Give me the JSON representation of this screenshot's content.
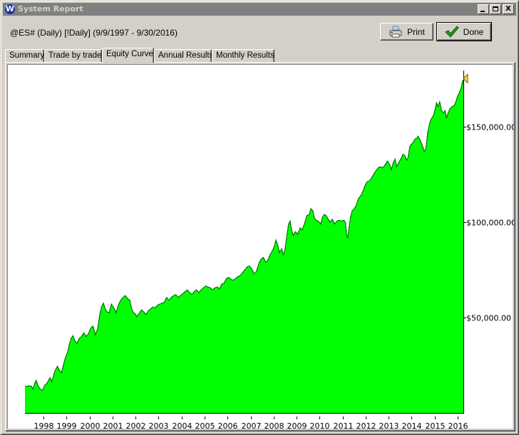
{
  "window": {
    "title": "System Report",
    "app_icon": "W",
    "controls": [
      "minimize-icon",
      "maximize-icon",
      "close-icon"
    ],
    "close_glyph": "X"
  },
  "header": {
    "subtitle": "@ES# (Daily) [!Daily]  (9/9/1997 - 9/30/2016)"
  },
  "buttons": {
    "print_label": "Print",
    "print_icon": "printer-icon",
    "done_label": "Done",
    "done_icon": "checkmark-icon"
  },
  "tabs": [
    {
      "label": "Summary",
      "active": false
    },
    {
      "label": "Trade by trade",
      "active": false
    },
    {
      "label": "Equity Curve",
      "active": true
    },
    {
      "label": "Annual Results",
      "active": false
    },
    {
      "label": "Monthly Results",
      "active": false
    }
  ],
  "colors": {
    "fill": "#00ff00",
    "line": "#007f00",
    "marker": "#ffdd33",
    "title_bar": "#808080",
    "title_text": "#d4d0c8"
  },
  "chart_data": {
    "type": "area",
    "title": "Equity Curve",
    "xlabel": "",
    "ylabel": "",
    "x_tick_labels": [
      "1998",
      "1999",
      "2000",
      "2001",
      "2002",
      "2003",
      "2004",
      "2005",
      "2006",
      "2007",
      "2008",
      "2009",
      "2010",
      "2011",
      "2012",
      "2013",
      "2014",
      "2015",
      "2016"
    ],
    "y_tick_labels": [
      "$50,000.00",
      "$100,000.00",
      "$150,000.00"
    ],
    "y_ticks": [
      50000,
      100000,
      150000
    ],
    "x_range": [
      1997.69,
      2016.75
    ],
    "ylim": [
      0,
      178000
    ],
    "y_axis_position": "right",
    "grid": false,
    "end_marker": "yellow-flag",
    "series": [
      {
        "name": "Equity",
        "points": [
          [
            1997.69,
            14000
          ],
          [
            1997.8,
            14000
          ],
          [
            1997.95,
            14200
          ],
          [
            1998.05,
            12500
          ],
          [
            1998.1,
            15000
          ],
          [
            1998.18,
            17000
          ],
          [
            1998.25,
            14500
          ],
          [
            1998.35,
            12500
          ],
          [
            1998.45,
            11800
          ],
          [
            1998.55,
            14500
          ],
          [
            1998.65,
            15500
          ],
          [
            1998.78,
            18500
          ],
          [
            1998.85,
            16500
          ],
          [
            1998.92,
            19000
          ],
          [
            1999.0,
            22000
          ],
          [
            1999.1,
            24500
          ],
          [
            1999.2,
            22000
          ],
          [
            1999.28,
            21000
          ],
          [
            1999.35,
            24500
          ],
          [
            1999.45,
            29000
          ],
          [
            1999.55,
            32000
          ],
          [
            1999.62,
            36000
          ],
          [
            1999.7,
            39000
          ],
          [
            1999.78,
            40500
          ],
          [
            1999.85,
            38000
          ],
          [
            1999.95,
            36500
          ],
          [
            2000.05,
            39000
          ],
          [
            2000.15,
            40000
          ],
          [
            2000.25,
            42000
          ],
          [
            2000.35,
            40000
          ],
          [
            2000.45,
            41500
          ],
          [
            2000.55,
            44500
          ],
          [
            2000.65,
            45500
          ],
          [
            2000.75,
            41000
          ],
          [
            2000.85,
            44000
          ],
          [
            2000.95,
            52000
          ],
          [
            2001.02,
            55500
          ],
          [
            2001.1,
            57500
          ],
          [
            2001.18,
            54500
          ],
          [
            2001.25,
            53000
          ],
          [
            2001.35,
            52500
          ],
          [
            2001.45,
            57000
          ],
          [
            2001.55,
            55000
          ],
          [
            2001.65,
            52500
          ],
          [
            2001.75,
            56500
          ],
          [
            2001.85,
            59000
          ],
          [
            2001.95,
            60500
          ],
          [
            2002.05,
            61500
          ],
          [
            2002.15,
            60000
          ],
          [
            2002.25,
            59000
          ],
          [
            2002.32,
            55000
          ],
          [
            2002.4,
            52500
          ],
          [
            2002.48,
            52000
          ],
          [
            2002.55,
            50500
          ],
          [
            2002.65,
            52000
          ],
          [
            2002.75,
            54000
          ],
          [
            2002.85,
            53000
          ],
          [
            2002.95,
            51500
          ],
          [
            2003.05,
            53500
          ],
          [
            2003.15,
            54500
          ],
          [
            2003.25,
            55500
          ],
          [
            2003.35,
            55000
          ],
          [
            2003.45,
            56500
          ],
          [
            2003.55,
            57000
          ],
          [
            2003.65,
            57500
          ],
          [
            2003.75,
            58000
          ],
          [
            2003.85,
            60500
          ],
          [
            2003.95,
            59000
          ],
          [
            2004.05,
            60500
          ],
          [
            2004.15,
            61500
          ],
          [
            2004.25,
            62000
          ],
          [
            2004.35,
            60500
          ],
          [
            2004.45,
            61500
          ],
          [
            2004.55,
            62500
          ],
          [
            2004.65,
            63500
          ],
          [
            2004.75,
            64500
          ],
          [
            2004.85,
            63000
          ],
          [
            2004.95,
            62000
          ],
          [
            2005.05,
            63500
          ],
          [
            2005.15,
            64500
          ],
          [
            2005.25,
            63000
          ],
          [
            2005.35,
            64500
          ],
          [
            2005.45,
            65500
          ],
          [
            2005.55,
            66500
          ],
          [
            2005.65,
            66000
          ],
          [
            2005.75,
            65500
          ],
          [
            2005.85,
            64500
          ],
          [
            2005.95,
            65500
          ],
          [
            2006.05,
            66000
          ],
          [
            2006.15,
            65000
          ],
          [
            2006.25,
            67500
          ],
          [
            2006.35,
            68000
          ],
          [
            2006.45,
            70500
          ],
          [
            2006.55,
            71000
          ],
          [
            2006.65,
            70000
          ],
          [
            2006.75,
            69500
          ],
          [
            2006.85,
            70500
          ],
          [
            2006.95,
            71500
          ],
          [
            2007.05,
            72000
          ],
          [
            2007.15,
            73500
          ],
          [
            2007.25,
            75000
          ],
          [
            2007.35,
            76500
          ],
          [
            2007.45,
            77000
          ],
          [
            2007.55,
            75500
          ],
          [
            2007.65,
            73000
          ],
          [
            2007.75,
            74000
          ],
          [
            2007.85,
            78000
          ],
          [
            2007.95,
            80500
          ],
          [
            2008.05,
            81500
          ],
          [
            2008.15,
            79000
          ],
          [
            2008.25,
            80000
          ],
          [
            2008.35,
            83000
          ],
          [
            2008.45,
            85000
          ],
          [
            2008.52,
            87000
          ],
          [
            2008.6,
            90500
          ],
          [
            2008.68,
            88000
          ],
          [
            2008.75,
            84000
          ],
          [
            2008.85,
            86000
          ],
          [
            2008.92,
            82500
          ],
          [
            2009.0,
            86000
          ],
          [
            2009.08,
            93000
          ],
          [
            2009.15,
            99000
          ],
          [
            2009.22,
            100500
          ],
          [
            2009.28,
            96000
          ],
          [
            2009.35,
            93000
          ],
          [
            2009.45,
            95000
          ],
          [
            2009.55,
            93500
          ],
          [
            2009.65,
            97000
          ],
          [
            2009.75,
            96000
          ],
          [
            2009.85,
            99500
          ],
          [
            2009.95,
            103500
          ],
          [
            2010.05,
            104000
          ],
          [
            2010.12,
            107000
          ],
          [
            2010.2,
            106000
          ],
          [
            2010.28,
            102000
          ],
          [
            2010.35,
            101000
          ],
          [
            2010.45,
            100500
          ],
          [
            2010.55,
            99000
          ],
          [
            2010.62,
            102500
          ],
          [
            2010.7,
            104000
          ],
          [
            2010.78,
            103500
          ],
          [
            2010.85,
            102000
          ],
          [
            2010.95,
            100000
          ],
          [
            2011.05,
            101500
          ],
          [
            2011.15,
            99000
          ],
          [
            2011.25,
            100500
          ],
          [
            2011.35,
            101000
          ],
          [
            2011.45,
            100500
          ],
          [
            2011.55,
            101000
          ],
          [
            2011.62,
            100000
          ],
          [
            2011.68,
            93000
          ],
          [
            2011.72,
            91500
          ],
          [
            2011.78,
            97000
          ],
          [
            2011.85,
            103000
          ],
          [
            2011.92,
            106000
          ],
          [
            2012.0,
            107000
          ],
          [
            2012.08,
            108500
          ],
          [
            2012.15,
            111000
          ],
          [
            2012.22,
            113000
          ],
          [
            2012.3,
            114000
          ],
          [
            2012.38,
            116000
          ],
          [
            2012.45,
            118500
          ],
          [
            2012.55,
            121000
          ],
          [
            2012.65,
            121500
          ],
          [
            2012.75,
            123000
          ],
          [
            2012.85,
            125000
          ],
          [
            2012.95,
            127000
          ],
          [
            2013.05,
            128500
          ],
          [
            2013.15,
            129000
          ],
          [
            2013.25,
            128500
          ],
          [
            2013.35,
            130000
          ],
          [
            2013.45,
            132000
          ],
          [
            2013.55,
            130000
          ],
          [
            2013.62,
            127500
          ],
          [
            2013.7,
            131000
          ],
          [
            2013.78,
            133000
          ],
          [
            2013.85,
            129000
          ],
          [
            2013.95,
            131500
          ],
          [
            2014.05,
            133500
          ],
          [
            2014.12,
            135500
          ],
          [
            2014.2,
            135000
          ],
          [
            2014.28,
            132500
          ],
          [
            2014.35,
            134000
          ],
          [
            2014.42,
            139500
          ],
          [
            2014.5,
            141000
          ],
          [
            2014.58,
            142000
          ],
          [
            2014.65,
            143500
          ],
          [
            2014.72,
            144000
          ],
          [
            2014.78,
            145000
          ],
          [
            2014.85,
            143500
          ],
          [
            2014.92,
            141500
          ],
          [
            2015.0,
            139000
          ],
          [
            2015.05,
            137000
          ],
          [
            2015.12,
            138500
          ],
          [
            2015.2,
            147000
          ],
          [
            2015.3,
            152500
          ],
          [
            2015.38,
            154500
          ],
          [
            2015.45,
            156000
          ],
          [
            2015.52,
            159000
          ],
          [
            2015.58,
            162500
          ],
          [
            2015.65,
            160500
          ],
          [
            2015.72,
            163000
          ],
          [
            2015.8,
            158500
          ],
          [
            2015.88,
            157000
          ],
          [
            2015.95,
            158500
          ],
          [
            2016.02,
            154500
          ],
          [
            2016.08,
            157000
          ],
          [
            2016.15,
            159000
          ],
          [
            2016.25,
            160500
          ],
          [
            2016.35,
            161000
          ],
          [
            2016.42,
            163000
          ],
          [
            2016.5,
            166000
          ],
          [
            2016.58,
            168000
          ],
          [
            2016.65,
            170000
          ],
          [
            2016.72,
            174000
          ],
          [
            2016.75,
            174500
          ]
        ]
      }
    ]
  }
}
